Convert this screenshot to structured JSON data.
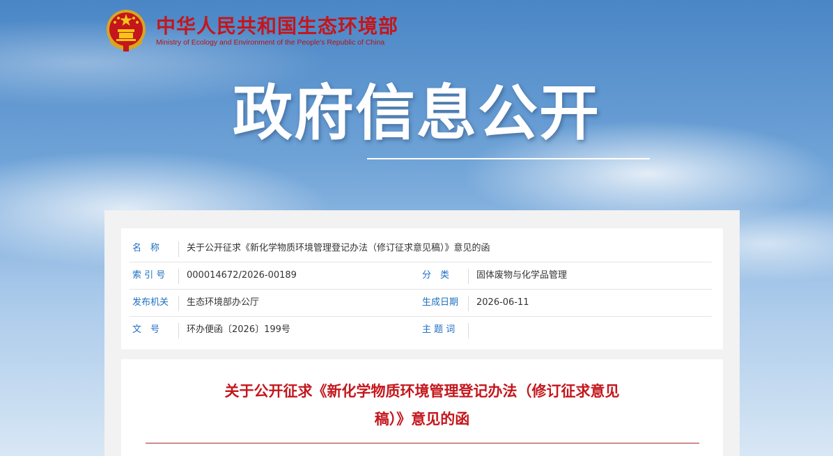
{
  "header": {
    "org_name_cn": "中华人民共和国生态环境部",
    "org_name_en": "Ministry of Ecology and Environment of the People's Republic of China",
    "emblem_icon": "national-emblem-icon",
    "brand_color": "#c4161c"
  },
  "banner": {
    "title": "政府信息公开"
  },
  "meta": {
    "label_color": "#1e6fc0",
    "name_label": "名　称",
    "name_value": "关于公开征求《新化学物质环境管理登记办法（修订征求意见稿）》意见的函",
    "index_label": "索 引 号",
    "index_value": "000014672/2026-00189",
    "category_label": "分　类",
    "category_value": "固体废物与化学品管理",
    "issuer_label": "发布机关",
    "issuer_value": "生态环境部办公厅",
    "date_label": "生成日期",
    "date_value": "2026-06-11",
    "docno_label": "文　号",
    "docno_value": "环办便函〔2026〕199号",
    "subject_label": "主 题 词",
    "subject_value": ""
  },
  "document": {
    "title_line1": "关于公开征求《新化学物质环境管理登记办法（修订征求意见",
    "title_line2": "稿）》意见的函"
  }
}
